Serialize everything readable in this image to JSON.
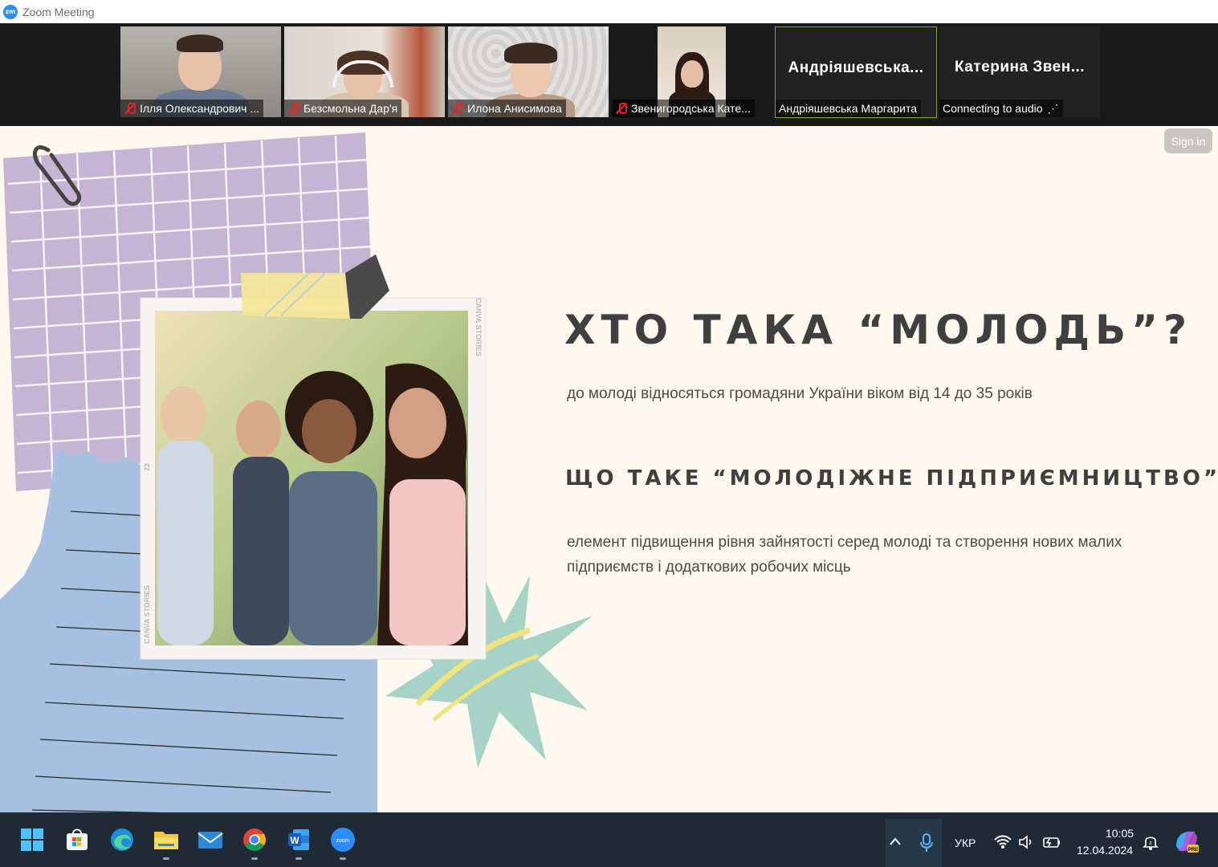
{
  "window": {
    "title": "Zoom Meeting",
    "logo_text": "zm"
  },
  "participants": [
    {
      "name": "Ілля Олександрович ...",
      "muted": true
    },
    {
      "name": "Безсмольна Дар'я",
      "muted": true
    },
    {
      "name": "Илона Анисимова",
      "muted": true
    },
    {
      "name": "Звенигородська Кате...",
      "muted": true
    },
    {
      "name": "Андріяшевська Маргарита",
      "display_name": "Андріяшевська...",
      "muted": false,
      "active_speaker": true
    },
    {
      "name": "Connecting to audio",
      "display_name": "Катерина Звен...",
      "connecting_indicator": "⋰"
    }
  ],
  "slide": {
    "sign_in_label": "Sign in",
    "heading1": "ХТО ТАКА “МОЛОДЬ”?",
    "text1": "до молоді відносяться громадяни України віком від 14 до 35 років",
    "heading2": "ЩО ТАКЕ “МОЛОДІЖНЕ ПІДПРИЄМНИЦТВО”?",
    "text2": "елемент підвищення рівня зайнятості серед молоді та створення нових малих підприємств і додаткових робочих місць",
    "photo_stamp_1": "CANVA STORIES",
    "photo_stamp_2": "CANVA STORIES",
    "photo_number": "23"
  },
  "taskbar": {
    "apps": [
      "start-icon",
      "store-icon",
      "edge-icon",
      "explorer-icon",
      "mail-icon",
      "chrome-icon",
      "word-icon",
      "zoom-icon"
    ],
    "language": "УКР",
    "time": "10:05",
    "date": "12.04.2024",
    "colors": {
      "taskbar": "#1f2a36",
      "accent": "#2d8cff"
    }
  }
}
